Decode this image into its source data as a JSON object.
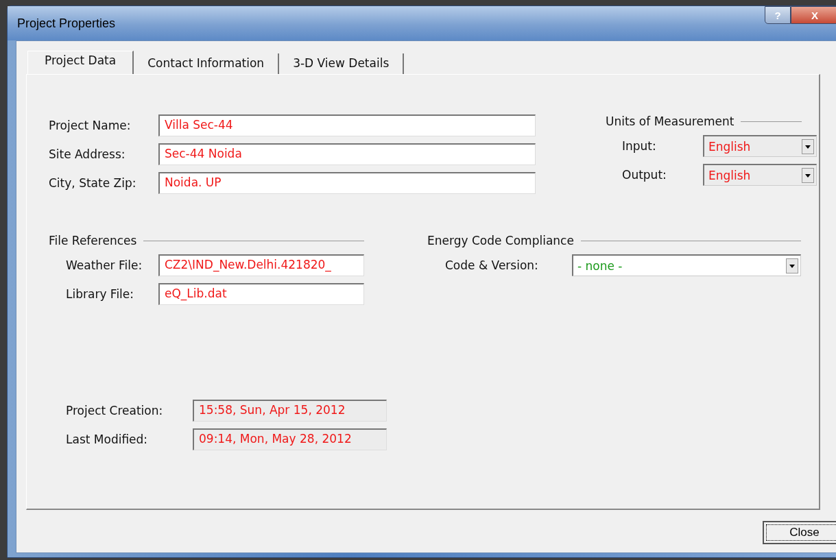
{
  "window": {
    "title": "Project Properties",
    "help_button": "?",
    "close_button": "X"
  },
  "tabs": [
    {
      "label": "Project Data",
      "selected": true
    },
    {
      "label": "Contact Information",
      "selected": false
    },
    {
      "label": "3-D View Details",
      "selected": false
    }
  ],
  "project_fields": [
    {
      "label": "Project Name:",
      "value": "Villa Sec-44"
    },
    {
      "label": "Site Address:",
      "value": "Sec-44 Noida"
    },
    {
      "label": "City, State Zip:",
      "value": "Noida. UP"
    }
  ],
  "units": {
    "title": "Units of Measurement",
    "rows": [
      {
        "label": "Input:",
        "value": "English"
      },
      {
        "label": "Output:",
        "value": "English"
      }
    ]
  },
  "file_references": {
    "title": "File References",
    "fields": [
      {
        "label": "Weather File:",
        "value": "CZ2\\IND_New.Delhi.421820_"
      },
      {
        "label": "Library File:",
        "value": "eQ_Lib.dat"
      }
    ]
  },
  "energy_code": {
    "title": "Energy Code Compliance",
    "label": "Code & Version:",
    "value": "- none -"
  },
  "dates": [
    {
      "label": "Project Creation:",
      "value": "15:58, Sun, Apr 15, 2012"
    },
    {
      "label": "Last Modified:",
      "value": "09:14, Mon, May 28, 2012"
    }
  ],
  "buttons": [
    "Close"
  ]
}
